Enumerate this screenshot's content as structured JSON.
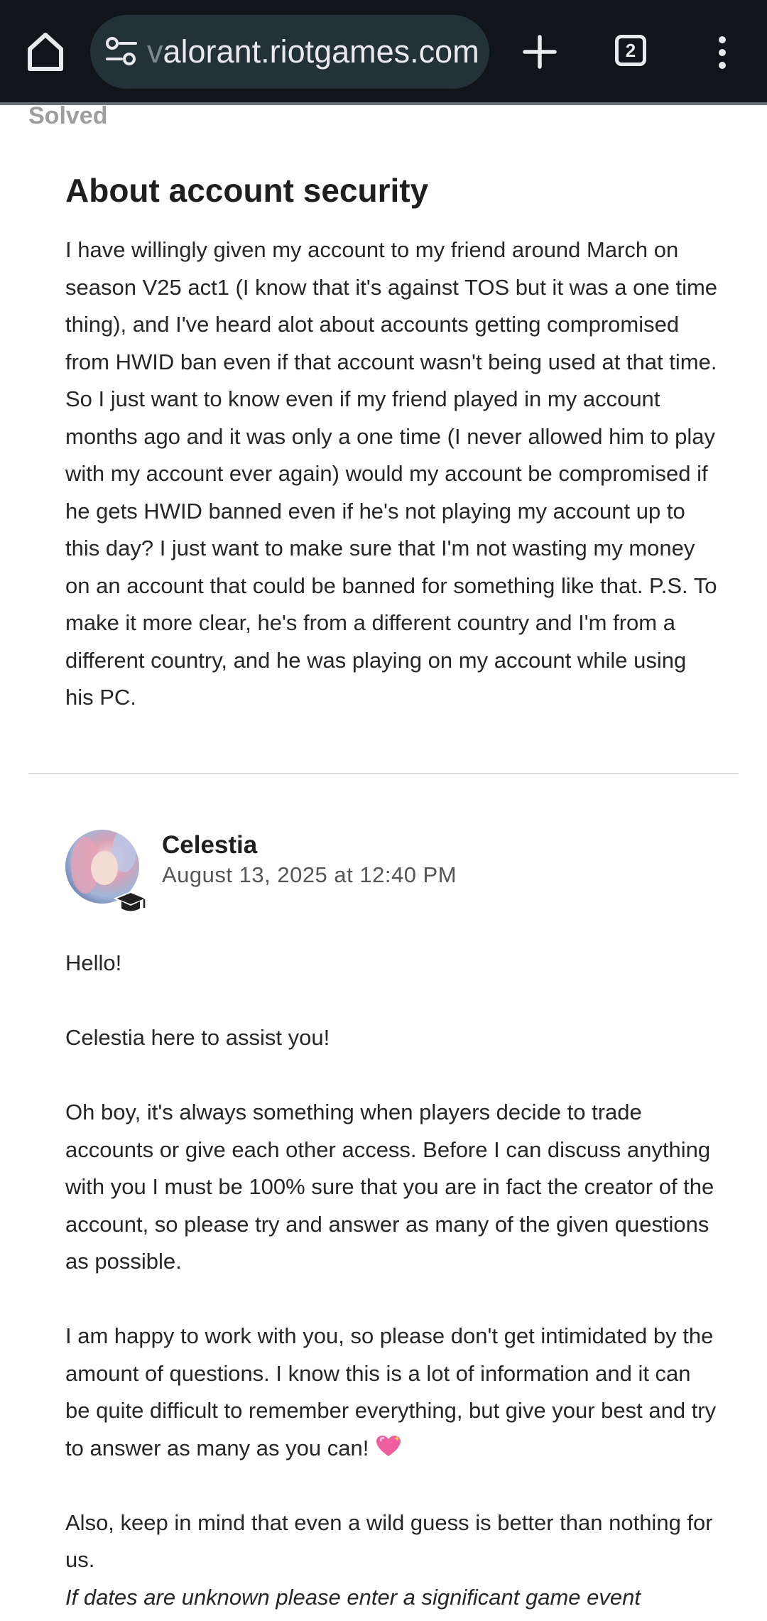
{
  "browser": {
    "url_faded": "v",
    "url_text": "alorant.riotgames.com",
    "tab_count": "2",
    "icons": [
      "home-icon",
      "site-settings-icon",
      "new-tab-icon",
      "tab-switcher-icon",
      "more-menu-icon"
    ],
    "colors": {
      "toolbar_bg": "#111419",
      "urlbar_bg": "#233239"
    }
  },
  "post": {
    "status": "Solved",
    "title": "About account security",
    "body": "I have willingly given my account to my friend around March on season V25 act1 (I know that it's against TOS but it was a one time thing), and I've heard alot about accounts getting compromised from HWID ban even if that account wasn't being used at that time. So I just want to know even if my friend played in my account months ago and it was only a one time (I never allowed him to play with my account ever again) would my account be compromised if he gets HWID banned even if he's not playing my account up to this day? I just want to make sure that I'm not wasting my money on an account that could be banned for something like that. P.S. To make it more clear, he's from a different country and I'm from a different country, and he was playing on my account while using his PC."
  },
  "reply": {
    "author": "Celestia",
    "date": "August 13, 2025 at 12:40 PM",
    "paragraphs": {
      "p1": "Hello!",
      "p2": "Celestia here to assist you!",
      "p3": "Oh boy, it's always something when players decide to trade accounts or give each other access. Before I can discuss anything with you I must be 100% sure that you are in fact the creator of the account, so please try and answer as many of the given questions as possible.",
      "p4": "I am happy to work with you, so please don't get intimidated by the amount of questions. I know this is a lot of information and it can be quite difficult to remember everything, but give your best and try to answer as many as you can!",
      "p5": "Also, keep in mind that even a wild guess is better than nothing for us.",
      "p6": "If dates are unknown please enter a significant game event"
    }
  }
}
